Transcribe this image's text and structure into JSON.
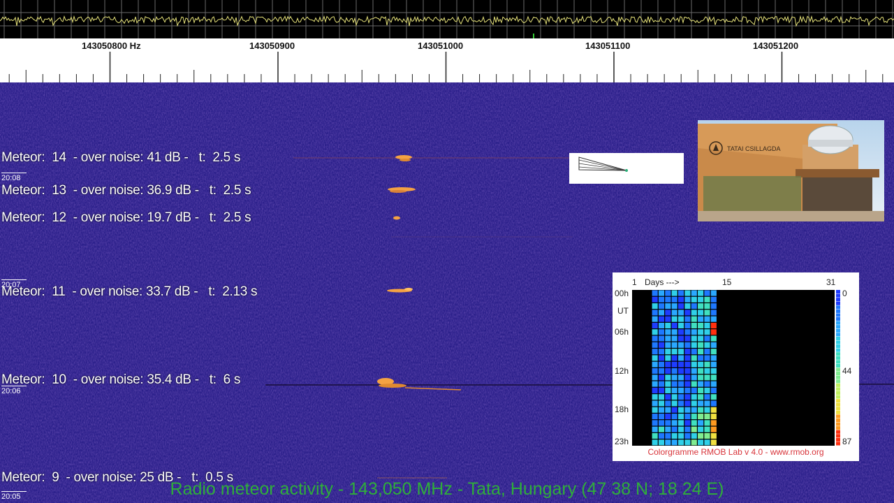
{
  "frequency_ticks": [
    "143050800 Hz",
    "143050900",
    "143051000",
    "143051100",
    "143051200"
  ],
  "meteors": [
    {
      "label": "Meteor:  14  - over noise: 41 dB -   t:  2.5 s"
    },
    {
      "label": "Meteor:  13  - over noise: 36.9 dB -   t:  2.5 s"
    },
    {
      "label": "Meteor:  12  - over noise: 19.7 dB -   t:  2.5 s"
    },
    {
      "label": "Meteor:  11  - over noise: 33.7 dB -   t:  2.13 s"
    },
    {
      "label": "Meteor:  10  - over noise: 35.4 dB -   t:  6 s"
    },
    {
      "label": "Meteor:  9  - over noise: 25 dB -   t:  0.5 s"
    }
  ],
  "time_marks": [
    "20:08",
    "20:07",
    "20:06",
    "20:05"
  ],
  "footer": "Radio meteor activity - 143,050 MHz - Tata, Hungary (47 38 N; 18 24 E)",
  "photo": {
    "sign": "TATAI CSILLAGDA"
  },
  "colorgram": {
    "top_label_1": "1",
    "top_label_days": "Days --->",
    "top_label_15": "15",
    "top_label_31": "31",
    "rows": [
      "00h",
      "UT",
      "06h",
      "12h",
      "18h",
      "23h"
    ],
    "scale": [
      "0",
      "44",
      "87"
    ],
    "footer": "Colorgramme RMOB Lab v 4.0 - www.rmob.org"
  },
  "colors": {
    "waterfall_bg": "#2a1f8a",
    "trace": "#e6e27a",
    "footer_text": "#2fae3a",
    "echo": "#f5a243"
  }
}
